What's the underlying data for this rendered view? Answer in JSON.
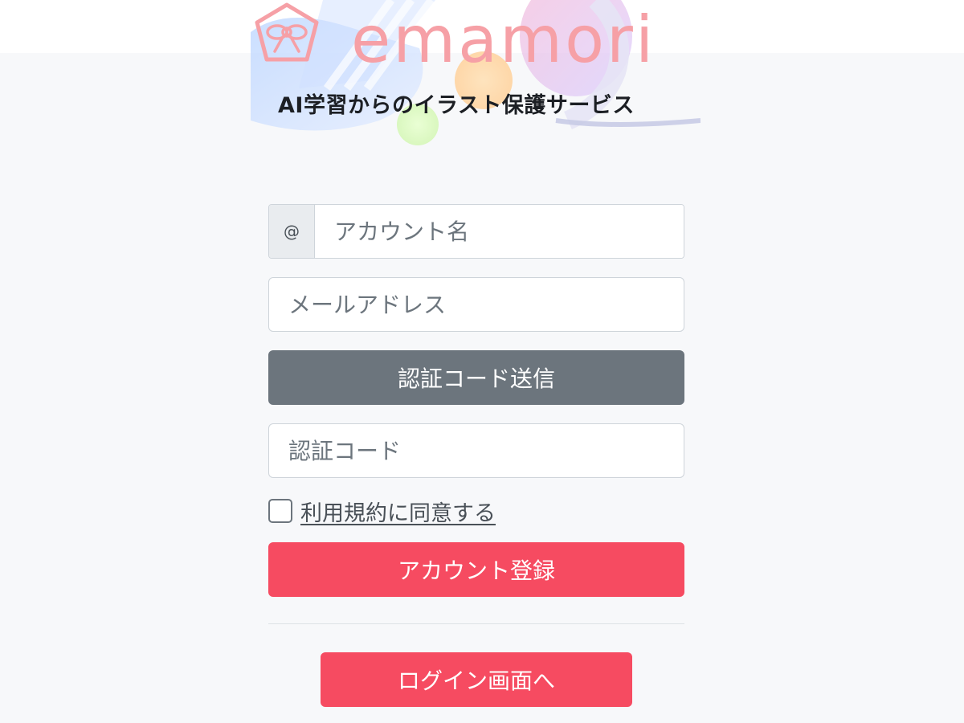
{
  "brand": {
    "logo_text": "emamori",
    "tagline": "AI学習からのイラスト保護サービス",
    "color": "#f6a0a6"
  },
  "form": {
    "account_prefix": "@",
    "account_placeholder": "アカウント名",
    "email_placeholder": "メールアドレス",
    "send_code_label": "認証コード送信",
    "code_placeholder": "認証コード",
    "terms_label": "利用規約に同意する",
    "terms_checked": false,
    "register_label": "アカウント登録",
    "login_label": "ログイン画面へ"
  },
  "colors": {
    "primary": "#f64b61",
    "secondary": "#6c757d",
    "background": "#f7f8fa"
  }
}
